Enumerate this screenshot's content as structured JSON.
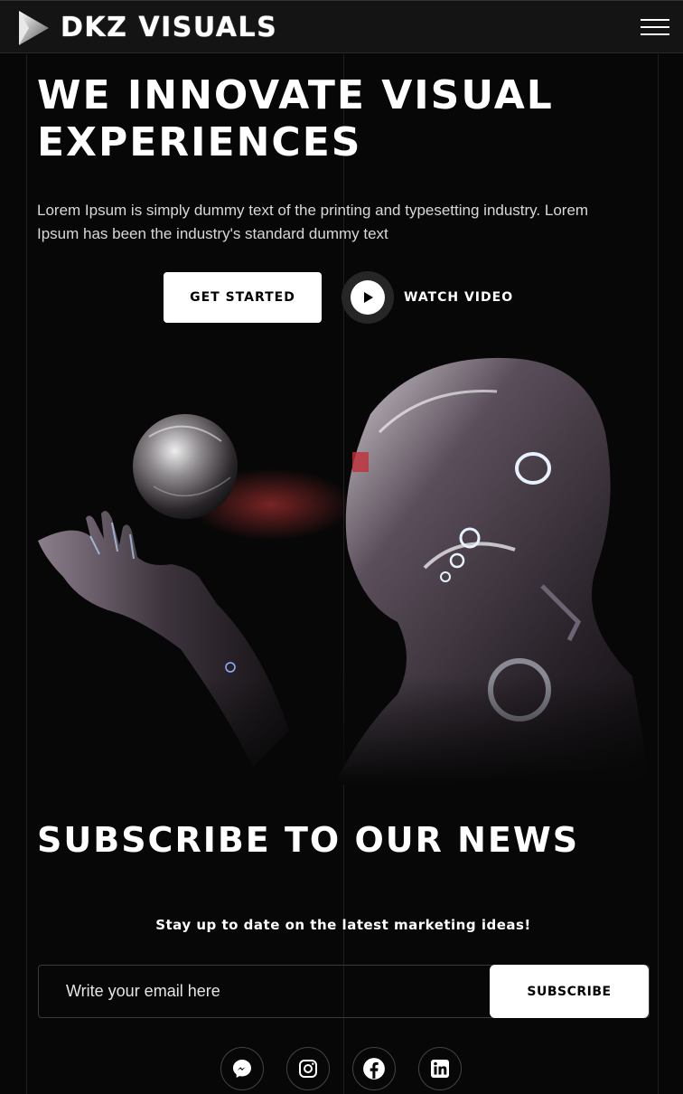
{
  "header": {
    "brand": "DKZ VISUALS",
    "logo_icon": "play-triangle-logo-icon",
    "menu_icon": "hamburger-menu-icon"
  },
  "hero": {
    "title": "WE INNOVATE VISUAL EXPERIENCES",
    "text": "Lorem Ipsum is simply dummy text of the printing and typesetting industry. Lorem Ipsum has been the industry's standard dummy text",
    "cta_label": "GET STARTED",
    "video_label": "WATCH VIDEO",
    "video_icon": "play-icon"
  },
  "subscribe": {
    "title": "SUBSCRIBE TO OUR NEWS",
    "text": "Stay up to date on the latest marketing ideas!",
    "email_placeholder": "Write your email here",
    "button_label": "SUBSCRIBE"
  },
  "socials": [
    "messenger-icon",
    "instagram-icon",
    "facebook-icon",
    "linkedin-icon"
  ],
  "colors": {
    "background": "#070707",
    "header": "#141414",
    "button": "#ffffff",
    "accent_glow": "#b8d8ff"
  }
}
